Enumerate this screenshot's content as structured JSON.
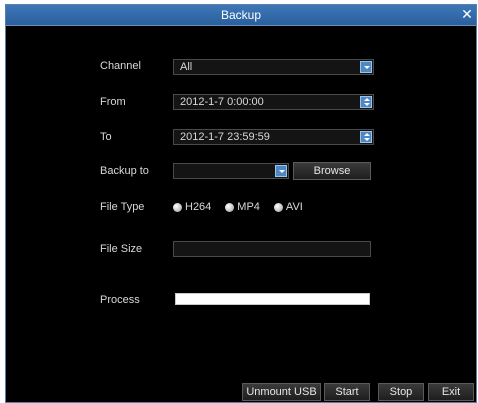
{
  "window": {
    "title": "Backup",
    "close_glyph": "✕"
  },
  "form": {
    "channel": {
      "label": "Channel",
      "value": "All"
    },
    "from": {
      "label": "From",
      "value": "2012-1-7 0:00:00"
    },
    "to": {
      "label": "To",
      "value": "2012-1-7 23:59:59"
    },
    "backup_to": {
      "label": "Backup to",
      "value": "",
      "browse_label": "Browse"
    },
    "file_type": {
      "label": "File Type",
      "options": [
        "H264",
        "MP4",
        "AVI"
      ]
    },
    "file_size": {
      "label": "File Size",
      "value": ""
    },
    "process": {
      "label": "Process",
      "progress": 0
    }
  },
  "buttons": {
    "unmount_usb": "Unmount USB",
    "start": "Start",
    "stop": "Stop",
    "exit": "Exit"
  },
  "colors": {
    "title_bar": "#3d77b8",
    "background": "#000000",
    "accent": "#4e87c2"
  }
}
